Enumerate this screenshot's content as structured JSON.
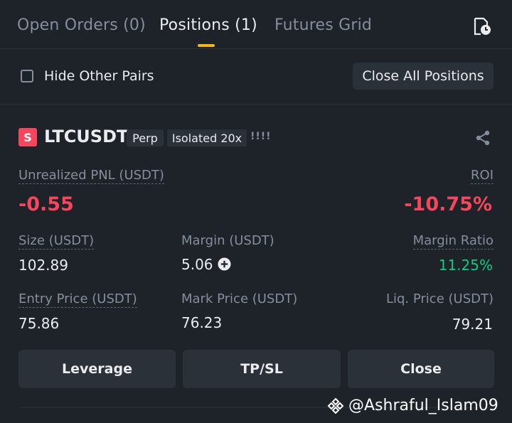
{
  "tabs": [
    {
      "label": "Open Orders (0)"
    },
    {
      "label": "Positions (1)"
    },
    {
      "label": "Futures Grid"
    }
  ],
  "filter": {
    "hide_label": "Hide Other Pairs",
    "close_all_label": "Close All Positions"
  },
  "position": {
    "side_badge": "S",
    "symbol": "LTCUSDT",
    "tag_perp": "Perp",
    "tag_margin": "Isolated 20x",
    "bars": "!!!!",
    "pnl_label": "Unrealized PNL (USDT)",
    "pnl_value": "-0.55",
    "roi_label": "ROI",
    "roi_value": "-10.75%",
    "size_label": "Size (USDT)",
    "size_value": "102.89",
    "margin_label": "Margin (USDT)",
    "margin_value": "5.06",
    "margin_ratio_label": "Margin Ratio",
    "margin_ratio_value": "11.25%",
    "entry_label": "Entry Price (USDT)",
    "entry_value": "75.86",
    "mark_label": "Mark Price (USDT)",
    "mark_value": "76.23",
    "liq_label": "Liq. Price (USDT)",
    "liq_value": "79.21"
  },
  "actions": {
    "leverage": "Leverage",
    "tpsl": "TP/SL",
    "close": "Close"
  },
  "watermark": "@Ashraful_Islam09",
  "colors": {
    "background": "#1e2329",
    "accent": "#f0b90b",
    "negative": "#f6465d",
    "positive": "#0ecb81"
  },
  "icons": [
    "history-icon",
    "share-icon",
    "plus-circle-icon",
    "binance-logo-icon"
  ]
}
